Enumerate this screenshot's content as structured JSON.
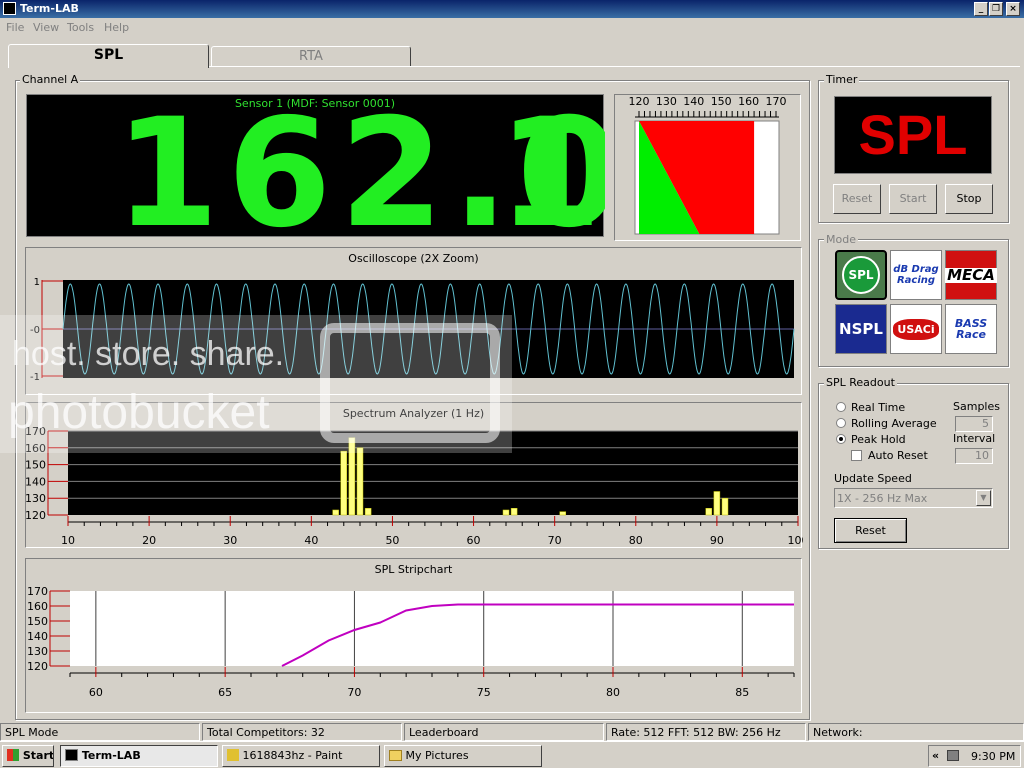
{
  "window": {
    "title": "Term-LAB"
  },
  "menu": [
    "File",
    "View",
    "Tools",
    "Help"
  ],
  "tabs": [
    {
      "label": "SPL"
    },
    {
      "label": "RTA"
    }
  ],
  "channel": {
    "label": "Channel A"
  },
  "display": {
    "sensor_label": "Sensor 1 (MDF: Sensor 0001)",
    "value": "162.0",
    "extra_digit": "1"
  },
  "meter": {
    "ticks": [
      "120",
      "130",
      "140",
      "150",
      "160",
      "170"
    ],
    "min": 120,
    "max": 170,
    "level": 162,
    "peak": 142
  },
  "oscilloscope": {
    "title": "Oscilloscope (2X Zoom)",
    "y_labels": [
      "1",
      "-0",
      "-1"
    ],
    "cycles": 25
  },
  "spectrum": {
    "title": "Spectrum Analyzer (1 Hz)"
  },
  "stripchart": {
    "title": "SPL Stripchart"
  },
  "timer": {
    "label": "Timer",
    "display": "SPL",
    "reset": "Reset",
    "start": "Start",
    "stop": "Stop"
  },
  "mode": {
    "label": "Mode",
    "buttons": [
      "SPL",
      "dB Drag Racing",
      "MECA",
      "NSPL",
      "USACi",
      "BASS Race"
    ]
  },
  "readout": {
    "label": "SPL Readout",
    "options": [
      "Real Time",
      "Rolling Average",
      "Peak Hold"
    ],
    "selected": "Peak Hold",
    "auto_reset": "Auto Reset",
    "samples_label": "Samples",
    "samples_value": "5",
    "interval_label": "Interval",
    "interval_value": "10",
    "update_label": "Update Speed",
    "update_value": "1X - 256 Hz Max",
    "reset": "Reset"
  },
  "status": {
    "mode": "SPL Mode",
    "competitors": "Total Competitors: 32",
    "leaderboard": "Leaderboard",
    "rate": "Rate: 512 FFT: 512 BW: 256 Hz",
    "network": "Network:"
  },
  "taskbar": {
    "start": "Start",
    "items": [
      "Term-LAB",
      "1618843hz - Paint",
      "My Pictures"
    ],
    "clock": "9:30 PM"
  },
  "watermark": {
    "line1": "host. store. share.",
    "line2": "photobucket"
  },
  "chart_data": [
    {
      "type": "bar",
      "ylim": [
        120,
        170
      ],
      "yticks": [
        120,
        130,
        140,
        150,
        160,
        170
      ],
      "xlim": [
        10,
        100
      ],
      "xticks": [
        10,
        20,
        30,
        40,
        50,
        60,
        70,
        80,
        90,
        100
      ],
      "x": [
        43,
        44,
        45,
        46,
        47,
        64,
        65,
        71,
        89,
        90,
        91
      ],
      "values": [
        123,
        158,
        166,
        160,
        124,
        123,
        124,
        122,
        124,
        134,
        130
      ]
    },
    {
      "type": "line",
      "ylim": [
        120,
        170
      ],
      "yticks": [
        120,
        130,
        140,
        150,
        160,
        170
      ],
      "xlim": [
        59,
        87
      ],
      "xticks": [
        60,
        65,
        70,
        75,
        80,
        85
      ],
      "color": "#c000c0",
      "x": [
        67.2,
        68,
        69,
        70,
        71,
        72,
        73,
        74,
        87
      ],
      "values": [
        120,
        127,
        137,
        144,
        149,
        157,
        160,
        161,
        161
      ]
    }
  ]
}
